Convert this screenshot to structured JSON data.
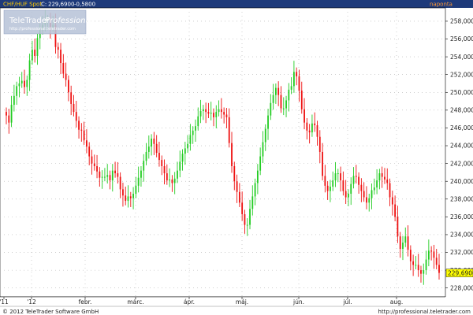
{
  "header": {
    "symbol": "CHF/HUF Spot",
    "last_prefix": "C:",
    "last_value": "229,6900",
    "change": "-0,5800",
    "interval": "naponta"
  },
  "logo": {
    "brand_a": "TeleTrader",
    "brand_b": "Professional",
    "url": "http://professional.teletrader.com"
  },
  "footer": {
    "copyright": "© 2012 TeleTrader Software GmbH",
    "url": "http://professional.teletrader.com"
  },
  "colors": {
    "up": "#22cc22",
    "down": "#ee1111",
    "title_bar": "#1e3a7a",
    "price_tag": "#ffff00"
  },
  "chart_data": {
    "type": "candlestick",
    "title": "CHF/HUF Spot",
    "ylim": [
      227,
      259.5
    ],
    "y_ticks": [
      "228,0000",
      "230,0000",
      "232,0000",
      "234,0000",
      "236,0000",
      "238,0000",
      "240,0000",
      "242,0000",
      "244,0000",
      "246,0000",
      "248,0000",
      "250,0000",
      "252,0000",
      "254,0000",
      "256,0000",
      "258,0000"
    ],
    "x_labels": [
      "'11",
      "'12",
      "febr.",
      "márc.",
      "ápr.",
      "máj.",
      "jún.",
      "júl.",
      "aug."
    ],
    "last_price": 229.69,
    "grid": true,
    "close": [
      247.4,
      246.6,
      248.6,
      249.6,
      250.7,
      251.0,
      251.3,
      250.6,
      251.4,
      253.6,
      254.8,
      254.1,
      256.1,
      257.0,
      257.6,
      258.0,
      258.2,
      257.3,
      257.6,
      255.1,
      254.8,
      253.3,
      252.1,
      251.4,
      250.0,
      248.7,
      247.8,
      246.8,
      245.8,
      245.7,
      244.6,
      243.9,
      242.8,
      242.0,
      241.7,
      241.1,
      240.4,
      240.5,
      240.5,
      240.7,
      240.1,
      241.2,
      240.9,
      240.5,
      239.1,
      238.4,
      237.8,
      238.3,
      238.1,
      238.6,
      239.5,
      240.4,
      241.2,
      242.3,
      243.3,
      243.9,
      244.8,
      244.2,
      243.2,
      242.4,
      241.7,
      240.9,
      240.1,
      240.2,
      239.8,
      240.3,
      241.2,
      242.2,
      243.1,
      243.7,
      244.2,
      245.2,
      245.7,
      246.2,
      247.3,
      247.9,
      248.1,
      247.8,
      247.6,
      247.7,
      247.2,
      247.8,
      248.1,
      247.8,
      247.5,
      247.2,
      244.3,
      241.7,
      240.0,
      238.8,
      237.6,
      236.3,
      235.1,
      235.1,
      236.9,
      238.3,
      239.8,
      241.2,
      242.8,
      244.4,
      245.9,
      247.4,
      248.8,
      249.7,
      250.5,
      249.7,
      248.2,
      248.2,
      249.1,
      250.3,
      250.7,
      252.3,
      251.8,
      250.2,
      248.1,
      246.6,
      245.7,
      245.5,
      246.5,
      246.3,
      245.0,
      243.3,
      240.6,
      239.5,
      238.9,
      239.4,
      240.1,
      240.9,
      240.9,
      240.1,
      238.9,
      238.2,
      238.6,
      239.7,
      240.6,
      240.5,
      239.6,
      238.9,
      238.2,
      237.6,
      238.1,
      239.0,
      239.3,
      240.1,
      240.9,
      240.5,
      240.2,
      239.8,
      238.2,
      237.4,
      236.0,
      233.8,
      232.4,
      233.1,
      233.8,
      232.3,
      231.0,
      230.6,
      230.6,
      230.0,
      229.6,
      230.0,
      231.2,
      232.2,
      232.1,
      231.4,
      230.6,
      229.7
    ]
  }
}
